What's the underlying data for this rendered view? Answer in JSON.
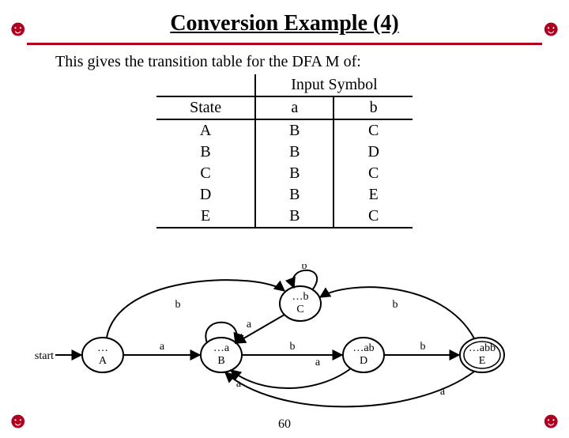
{
  "title": "Conversion Example (4)",
  "intro": "This gives the transition table for the DFA M of:",
  "table": {
    "group_header": "Input Symbol",
    "headers": {
      "state": "State",
      "a": "a",
      "b": "b"
    },
    "rows": [
      {
        "state": "A",
        "a": "B",
        "b": "C"
      },
      {
        "state": "B",
        "a": "B",
        "b": "D"
      },
      {
        "state": "C",
        "a": "B",
        "b": "C"
      },
      {
        "state": "D",
        "a": "B",
        "b": "E"
      },
      {
        "state": "E",
        "a": "B",
        "b": "C"
      }
    ]
  },
  "diagram": {
    "start_label": "start",
    "nodes": {
      "A": {
        "line1": "…",
        "line2": "A"
      },
      "B": {
        "line1": "…a",
        "line2": "B"
      },
      "C": {
        "line1": "…b",
        "line2": "C"
      },
      "D": {
        "line1": "…ab",
        "line2": "D"
      },
      "E": {
        "line1": "…abb",
        "line2": "E"
      }
    },
    "edges": {
      "A_B": "a",
      "B_B": "a",
      "A_C": "b",
      "B_D": "b",
      "D_E": "b",
      "C_C": "b",
      "E_C_top": "b",
      "D_B_bottom": "a",
      "C_B_left": "a",
      "E_B_bottom": "a"
    }
  },
  "page_number": "60"
}
